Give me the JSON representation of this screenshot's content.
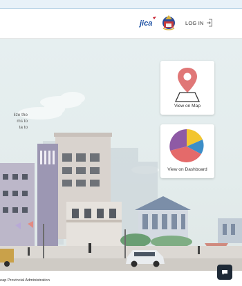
{
  "header": {
    "jica_logo_text": "JICA",
    "login_label": "LOG IN"
  },
  "hero": {
    "intro_lines": [
      "lize the",
      "ms to",
      "ta to"
    ]
  },
  "cards": {
    "map_label": "View on Map",
    "dashboard_label": "View on Dashboard"
  },
  "footer": {
    "text": "eap Provincial Administration"
  },
  "colors": {
    "pin": "#e07777",
    "pie_purple": "#8e5aa5",
    "pie_yellow": "#f2c530",
    "pie_blue": "#3c8ec8",
    "pie_red": "#e46a6a",
    "chat": "#1f2a37"
  }
}
